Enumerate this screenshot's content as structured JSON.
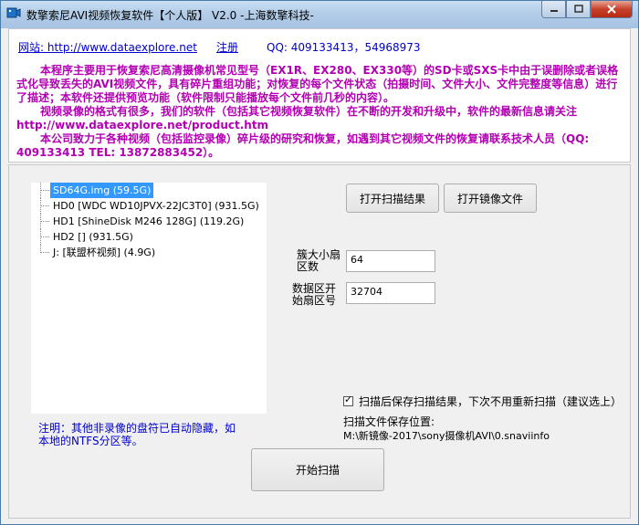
{
  "window": {
    "title": "数擎索尼AVI视频恢复软件【个人版】 V2.0  -上海数擎科技-"
  },
  "header": {
    "website": "网站: http://www.dataexplore.net",
    "register": "注册",
    "qq": "QQ: 409133413，54968973"
  },
  "description": {
    "p1": "本程序主要用于恢复索尼高清摄像机常见型号（EX1R、EX280、EX330等）的SD卡或SXS卡中由于误删除或者误格式化导致丢失的AVI视频文件，具有碎片重组功能；对恢复的每个文件状态（拍摄时间、文件大小、文件完整度等信息）进行了描述；本软件还提供预览功能（软件限制只能播放每个文件前几秒的内容）。",
    "p2": "视频录像的格式有很多，我们的软件（包括其它视频恢复软件）在不断的开发和升级中，软件的最新信息请关注 http://www.dataexplore.net/product.htm",
    "p3": "本公司致力于各种视频（包括监控录像）碎片级的研究和恢复，如遇到其它视频文件的恢复请联系技术人员（QQ: 409133413  TEL: 13872883452）。"
  },
  "tree": {
    "items": [
      {
        "label": "SD64G.img      (59.5G)"
      },
      {
        "label": "HD0   [WDC WD10JPVX-22JC3T0]  (931.5G)"
      },
      {
        "label": "HD1   [ShineDisk M246 128G]  (119.2G)"
      },
      {
        "label": "HD2   []  (931.5G)"
      },
      {
        "label": "J:    [联盟杯视频]  (4.9G)"
      }
    ]
  },
  "buttons": {
    "open_scan_result": "打开扫描结果",
    "open_image_file": "打开镜像文件",
    "start_scan": "开始扫描"
  },
  "fields": {
    "cluster_label": "簇大小扇区数",
    "cluster_value": "64",
    "start_sector_label": "数据区开始扇区号",
    "start_sector_value": "32704"
  },
  "options": {
    "save_result_label": "扫描后保存扫描结果，下次不用重新扫描（建议选上）",
    "save_result_checked": true,
    "save_path_label": "扫描文件保存位置:",
    "save_path_value": "M:\\新镜像-2017\\sony摄像机AVI\\0.snaviinfo"
  },
  "note": "注明：其他非录像的盘符已自动隐藏，如本地的NTFS分区等。"
}
